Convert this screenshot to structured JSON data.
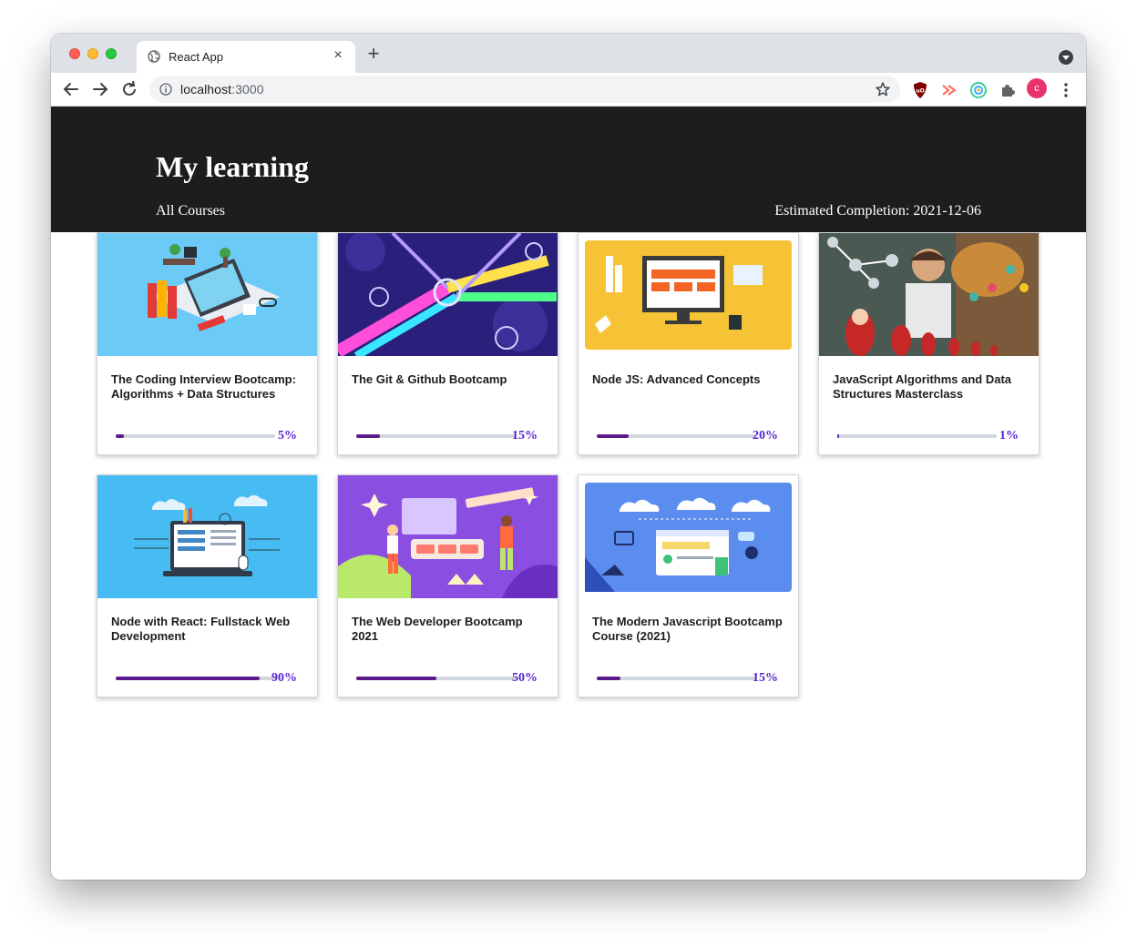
{
  "browser": {
    "tab_title": "React App",
    "new_tab_label": "+",
    "close_tab_label": "×",
    "url_host": "localhost",
    "url_port": ":3000",
    "profile_initial": "c"
  },
  "header": {
    "title": "My learning",
    "all_courses_link": "All Courses",
    "estimated_completion": "Estimated Completion: 2021-12-06"
  },
  "colors": {
    "hero_bg": "#1c1d1f",
    "progress_fill": "#5624d0",
    "progress_track": "#d1d7dc"
  },
  "courses": [
    {
      "title": "The Coding Interview Bootcamp: Algorithms + Data Structures",
      "progress_label": "5%",
      "progress": 0.05,
      "thumb_icon": "desk-laptop-illustration"
    },
    {
      "title": "The Git & Github Bootcamp",
      "progress_label": "15%",
      "progress": 0.15,
      "thumb_icon": "git-branches-illustration"
    },
    {
      "title": "Node JS: Advanced Concepts",
      "progress_label": "20%",
      "progress": 0.2,
      "thumb_icon": "monitor-illustration"
    },
    {
      "title": "JavaScript Algorithms and Data Structures Masterclass",
      "progress_label": "1%",
      "progress": 0.01,
      "thumb_icon": "nesting-dolls-photo"
    },
    {
      "title": "Node with React: Fullstack Web Development",
      "progress_label": "90%",
      "progress": 0.9,
      "thumb_icon": "laptop-circuit-illustration"
    },
    {
      "title": "The Web Developer Bootcamp 2021",
      "progress_label": "50%",
      "progress": 0.5,
      "thumb_icon": "web-builders-illustration"
    },
    {
      "title": "The Modern Javascript Bootcamp Course (2021)",
      "progress_label": "15%",
      "progress": 0.15,
      "thumb_icon": "cloud-browser-illustration"
    }
  ]
}
